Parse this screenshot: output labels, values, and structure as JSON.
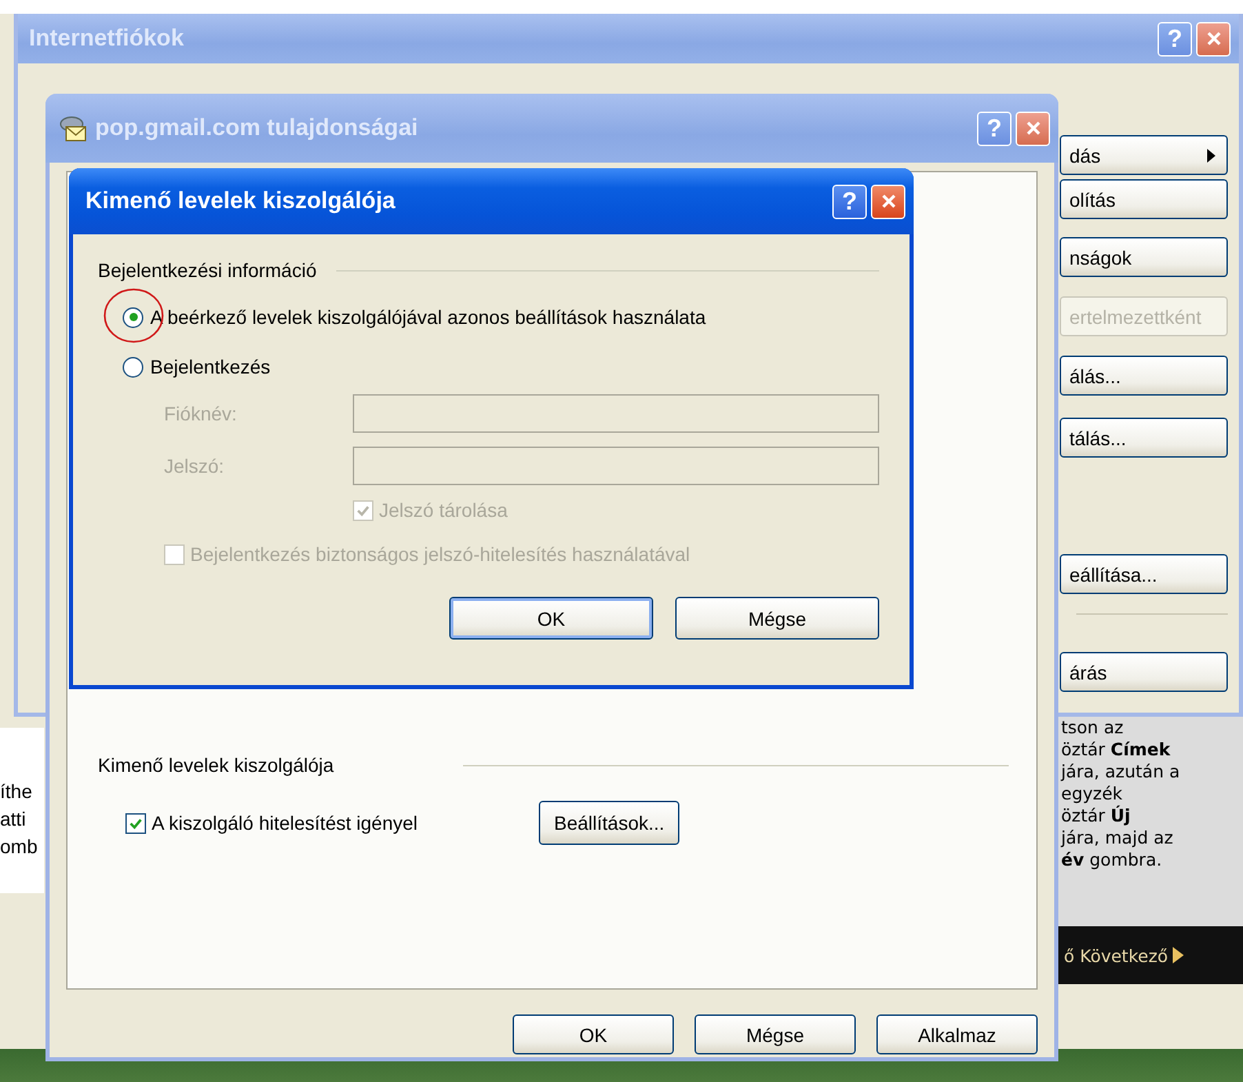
{
  "background_app": {
    "left_fragments": [
      "íthe",
      "atti",
      "omb"
    ],
    "help_lines": [
      "tson az",
      "öztár **Címek**",
      "jára, azután a",
      "egyzék",
      "öztár **Új**",
      "jára, majd az",
      "**év** gombra."
    ],
    "next_link": "ő Következő"
  },
  "accounts_window": {
    "title": "Internetfiókok",
    "help": "?",
    "active": false,
    "button_groups": [
      [
        {
          "label": "dás",
          "kind": "submenu",
          "disabled": false
        },
        {
          "label": "olítás",
          "kind": "button",
          "disabled": false
        }
      ],
      [
        {
          "label": "nságok",
          "kind": "button",
          "disabled": false
        },
        {
          "label": "ertelmezettként",
          "kind": "button",
          "disabled": true
        }
      ],
      [
        {
          "label": "álás...",
          "kind": "button",
          "disabled": false
        },
        {
          "label": "tálás...",
          "kind": "button",
          "disabled": false
        }
      ],
      [
        {
          "label": "eállítása...",
          "kind": "button",
          "disabled": false
        }
      ],
      [
        {
          "label": "árás",
          "kind": "button",
          "disabled": false
        }
      ]
    ]
  },
  "properties_window": {
    "title": "pop.gmail.com tulajdonságai",
    "help": "?",
    "active": false,
    "group_title": "Kimenő levelek kiszolgálója",
    "auth_checkbox": {
      "label": "A kiszolgáló hitelesítést igényel",
      "checked": true
    },
    "settings_button": "Beállítások...",
    "buttons": [
      {
        "label": "OK",
        "default": false
      },
      {
        "label": "Mégse",
        "default": false
      },
      {
        "label": "Alkalmaz",
        "default": false
      }
    ]
  },
  "outgoing_dialog": {
    "title": "Kimenő levelek kiszolgálója",
    "help": "?",
    "active": true,
    "group_title": "Bejelentkezési információ",
    "radios": [
      {
        "label": "A beérkező levelek kiszolgálójával azonos beállítások használata",
        "selected": true
      },
      {
        "label": "Bejelentkezés",
        "selected": false
      }
    ],
    "fields": [
      {
        "label": "Fióknév:",
        "disabled": true
      },
      {
        "label": "Jelszó:",
        "disabled": true
      }
    ],
    "checkboxes": [
      {
        "label": "Jelszó tárolása",
        "checked": true,
        "disabled": true,
        "kind": "indented"
      },
      {
        "label": "Bejelentkezés biztonságos jelszó-hitelesítés használatával",
        "checked": false,
        "disabled": true,
        "kind": "plain"
      }
    ],
    "buttons": [
      {
        "label": "OK",
        "default": true
      },
      {
        "label": "Mégse",
        "default": false
      }
    ]
  }
}
